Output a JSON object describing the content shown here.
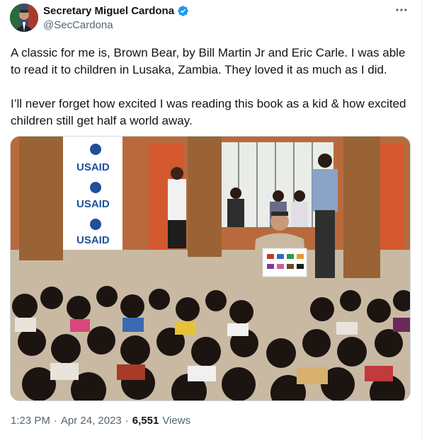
{
  "tweet": {
    "author_name": "Secretary Miguel Cardona",
    "author_handle": "@SecCardona",
    "more_icon": "more-dots-icon",
    "verified_icon": "verified-badge-icon",
    "paragraphs": [
      "A classic for me is, Brown Bear, by Bill Martin Jr and Eric Carle. I was able to read it to children in Lusaka, Zambia. They loved it as much as I did.",
      "I’ll never forget how excited I was reading this book as a kid & how excited children still get half a world away."
    ],
    "time": "1:23 PM",
    "date": "Apr 24, 2023",
    "separator": "·",
    "views_count": "6,551",
    "views_label": "Views"
  },
  "photo": {
    "banner_text": [
      "USAID",
      "USAID",
      "USAID"
    ],
    "colors": {
      "wall": "#b86a3c",
      "floor": "#c9b9a3",
      "pillar": "#9a6336",
      "shelf": "#d4582e",
      "banner": "#ffffff",
      "usaid_blue": "#1f4f9a",
      "usaid_red": "#c8102e",
      "suit": "#c8b9a0"
    }
  },
  "colors": {
    "text": "#0f1419",
    "secondary": "#536471",
    "verified": "#1d9bf0",
    "border": "#cfd9de"
  }
}
